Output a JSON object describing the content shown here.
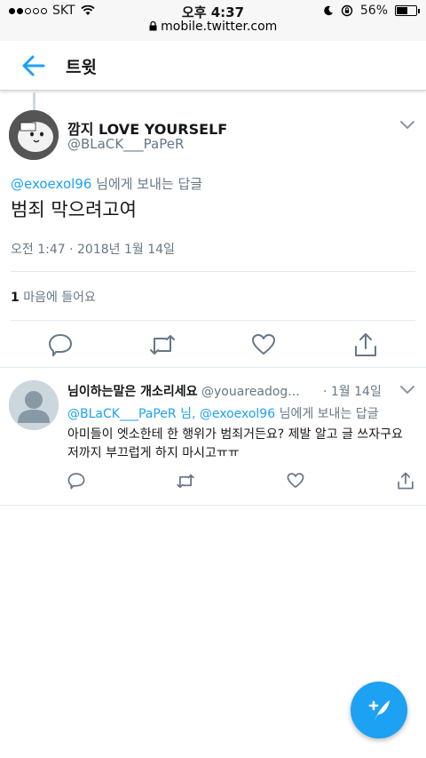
{
  "status_bar": {
    "carrier": "SKT",
    "time": "오후 4:37",
    "url": "mobile.twitter.com",
    "battery": "56%",
    "battery_level": 0.56
  },
  "header": {
    "title": "트윗"
  },
  "main_tweet": {
    "author_name": "깜지 LOVE YOURSELF",
    "author_handle": "@BLaCK___PaPeR",
    "reply_to_handle": "@exoexol96",
    "reply_to_suffix": " 님에게 보내는 답글",
    "text": "범죄 막으려고여",
    "timestamp": "오전 1:47 · 2018년 1월 14일",
    "likes_count": "1",
    "likes_label": " 마음에 들어요"
  },
  "reply_tweet": {
    "author_name": "님이하는말은 개소리세요",
    "author_handle": "@youareadog...",
    "date": "· 1월 14일",
    "reply_handles": "@BLaCK___PaPeR 님, @exoexol96",
    "reply_suffix": " 님에게 보내는 답글",
    "text": "아미들이 엣소한테 한 행위가 범죄거든요? 제발 알고 글 쓰자구요 저까지 부끄럽게 하지 마시고ㅠㅠ"
  },
  "icons": {
    "back": "arrow-left-icon",
    "more": "chevron-down-icon",
    "reply": "reply-icon",
    "retweet": "retweet-icon",
    "like": "heart-icon",
    "share": "share-icon",
    "compose": "compose-tweet-icon"
  },
  "colors": {
    "accent": "#1da1f2",
    "secondary_text": "#657786"
  }
}
